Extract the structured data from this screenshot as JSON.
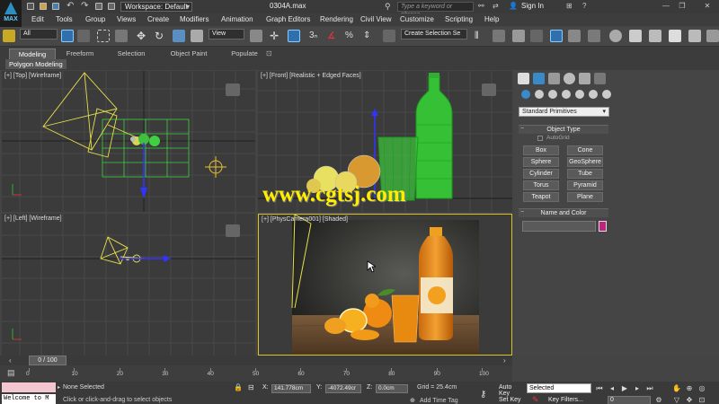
{
  "window": {
    "logo_text": "MAX",
    "file_name": "0304A.max",
    "workspace": "Workspace: Default",
    "search_placeholder": "Type a keyword or phrase",
    "sign_in": "Sign In"
  },
  "menu": [
    "Edit",
    "Tools",
    "Group",
    "Views",
    "Create",
    "Modifiers",
    "Animation",
    "Graph Editors",
    "Rendering",
    "Civil View",
    "Customize",
    "Scripting",
    "Help"
  ],
  "toolbar": {
    "selection_filter": "All",
    "ref_coord": "View",
    "named_selection": "Create Selection Se"
  },
  "ribbon": {
    "tabs": [
      "Modeling",
      "Freeform",
      "Selection",
      "Object Paint",
      "Populate"
    ],
    "active_tab": "Modeling",
    "panel": "Polygon Modeling"
  },
  "viewports": {
    "top": "[+] [Top] [Wireframe]",
    "front": "[+] [Front] [Realistic + Edged Faces]",
    "left": "[+] [Left] [Wireframe]",
    "camera": "[+] [PhysCamera001] [Shaded]"
  },
  "watermark": "www.cgtsj.com",
  "command_panel": {
    "category": "Standard Primitives",
    "object_type_title": "Object Type",
    "autogrid": "AutoGrid",
    "buttons": [
      "Box",
      "Cone",
      "Sphere",
      "GeoSphere",
      "Cylinder",
      "Tube",
      "Torus",
      "Pyramid",
      "Teapot",
      "Plane"
    ],
    "name_color_title": "Name and Color",
    "object_color": "#c0237e"
  },
  "timeline": {
    "current": "0 / 100",
    "ticks": [
      "0",
      "10",
      "20",
      "30",
      "40",
      "50",
      "60",
      "70",
      "80",
      "90",
      "100"
    ]
  },
  "status": {
    "listener_text": "Welcome to M",
    "selection": "None Selected",
    "prompt": "Click or click-and-drag to select objects",
    "x_label": "X:",
    "x": "141.778cm",
    "y_label": "Y:",
    "y": "-4072.49cr",
    "z_label": "Z:",
    "z": "0.0cm",
    "grid": "Grid = 25.4cm",
    "add_time_tag": "Add Time Tag",
    "auto_key": "Auto Key",
    "set_key": "Set Key",
    "key_mode": "Selected",
    "key_filters": "Key Filters...",
    "frame": "0"
  }
}
